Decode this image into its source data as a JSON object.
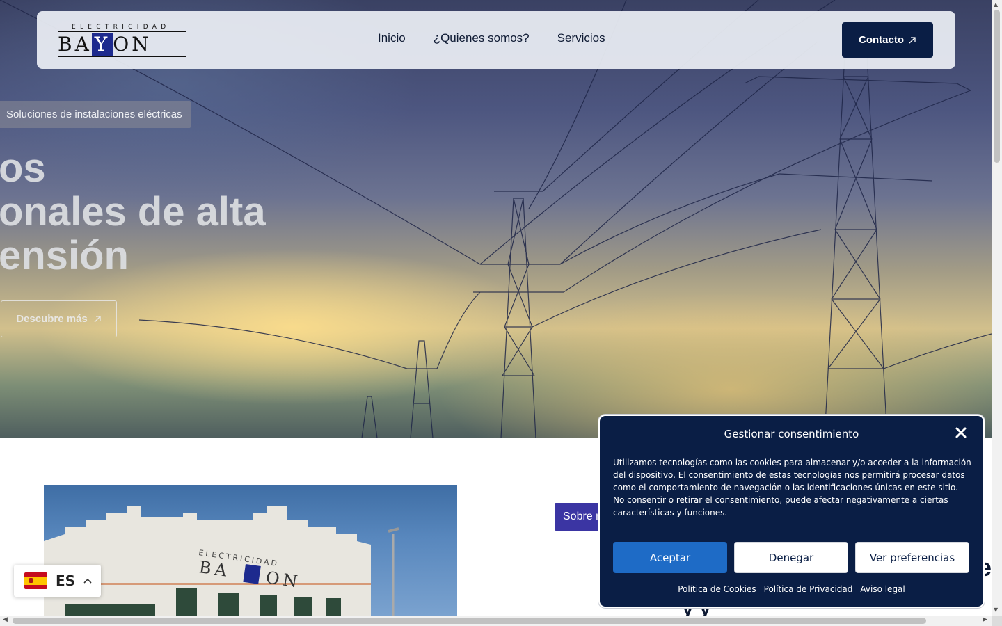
{
  "brand": {
    "small_text": "ELECTRICIDAD",
    "name_b": "BA",
    "name_y": "Y",
    "name_on": "ON"
  },
  "nav": {
    "links": [
      "Inicio",
      "¿Quienes somos?",
      "Servicios"
    ],
    "contact_label": "Contacto",
    "contact_icon": "arrow-up-right-icon"
  },
  "hero": {
    "badge": "Soluciones de instalaciones eléctricas",
    "headline_lines": [
      "os",
      "onales de alta",
      "ensión"
    ],
    "cta_label": "Descubre más",
    "cta_icon": "arrow-up-right-icon"
  },
  "about": {
    "badge_label": "Sobre nosotros",
    "peek_letter": "e",
    "peek_text": "y y"
  },
  "consent": {
    "title": "Gestionar consentimiento",
    "body": "Utilizamos tecnologías como las cookies para almacenar y/o acceder a la información del dispositivo. El consentimiento de estas tecnologías nos permitirá procesar datos como el comportamiento de navegación o las identificaciones únicas en este sitio. No consentir o retirar el consentimiento, puede afectar negativamente a ciertas características y funciones.",
    "accept_label": "Aceptar",
    "deny_label": "Denegar",
    "prefs_label": "Ver preferencias",
    "links": [
      "Política de Cookies",
      "Política de Privacidad",
      "Aviso legal"
    ]
  },
  "language": {
    "code": "ES",
    "flag": "spain-flag-icon",
    "caret": "^"
  },
  "colors": {
    "navy": "#0a1e45",
    "accept_blue": "#1e6bc6",
    "about_badge": "#3b35a3",
    "brand_blue": "#1d2a8e"
  }
}
